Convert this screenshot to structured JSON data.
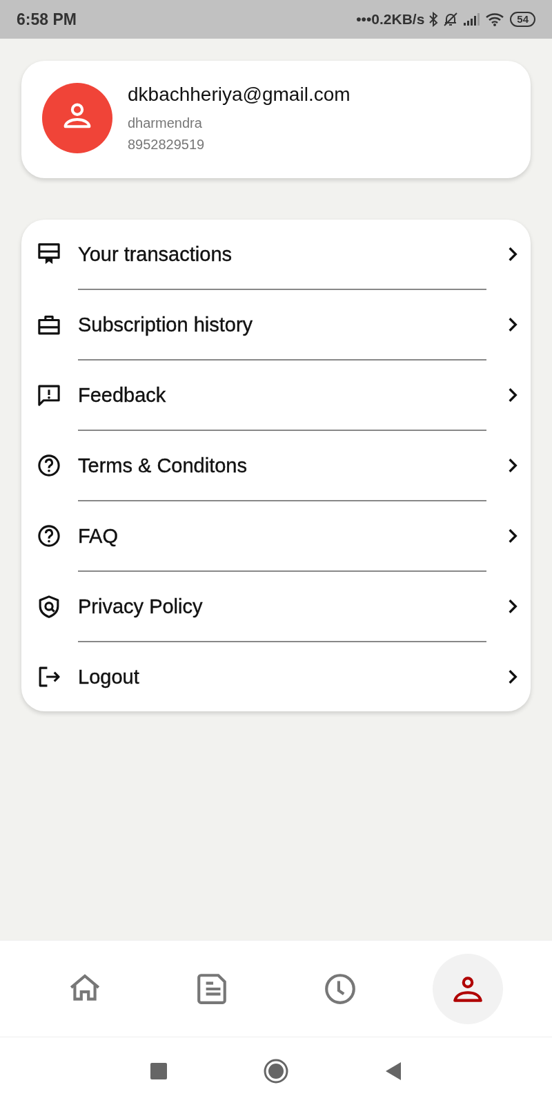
{
  "status_bar": {
    "time": "6:58 PM",
    "net_speed": "•••0.2KB/s",
    "battery": "54"
  },
  "profile": {
    "email": "dkbachheriya@gmail.com",
    "name": "dharmendra",
    "phone": "8952829519"
  },
  "menu": [
    {
      "label": "Your transactions"
    },
    {
      "label": "Subscription history"
    },
    {
      "label": "Feedback"
    },
    {
      "label": "Terms & Conditons"
    },
    {
      "label": "FAQ"
    },
    {
      "label": "Privacy Policy"
    },
    {
      "label": "Logout"
    }
  ],
  "bottom_nav": [
    {
      "selected": false
    },
    {
      "selected": false
    },
    {
      "selected": false
    },
    {
      "selected": true
    }
  ]
}
